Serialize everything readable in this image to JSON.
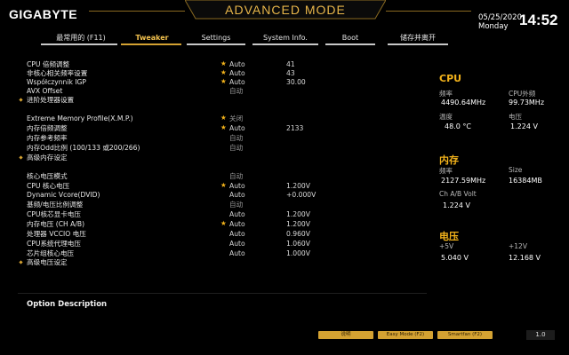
{
  "header": {
    "logo": "GIGABYTE",
    "title": "ADVANCED MODE",
    "date": "05/25/2020",
    "weekday": "Monday",
    "time": "14:52"
  },
  "tabs": [
    {
      "label": "最常用的 (F11)"
    },
    {
      "label": "Tweaker",
      "active": true
    },
    {
      "label": "Settings"
    },
    {
      "label": "System Info."
    },
    {
      "label": "Boot"
    },
    {
      "label": "储存并离开"
    }
  ],
  "rows": [
    {
      "label": "CPU 倍频调整",
      "star": true,
      "v1": "Auto",
      "v2": "41"
    },
    {
      "label": "非核心相关频率设置",
      "star": true,
      "v1": "Auto",
      "v2": "43"
    },
    {
      "label": "Współczynnik IGP",
      "star": true,
      "v1": "Auto",
      "v2": "30.00"
    },
    {
      "label": "AVX Offset",
      "star": false,
      "v1": "自动",
      "v1dim": true,
      "v2": ""
    },
    {
      "label": "进阶处理器设置",
      "bullet": true
    },
    {
      "label": "Extreme Memory Profile(X.M.P.)",
      "star": true,
      "v1": "关闭",
      "v1dim": true,
      "v2": ""
    },
    {
      "label": "内存倍频调整",
      "star": true,
      "v1": "Auto",
      "v2": "2133"
    },
    {
      "label": "内存参考频率",
      "star": false,
      "v1": "自动",
      "v1dim": true,
      "v2": ""
    },
    {
      "label": "内存Odd比例 (100/133 或200/266)",
      "star": false,
      "v1": "自动",
      "v1dim": true,
      "v2": ""
    },
    {
      "label": "高级内存设定",
      "bullet": true
    },
    {
      "label": "核心电压模式",
      "star": false,
      "v1": "自动",
      "v1dim": true,
      "v2": ""
    },
    {
      "label": "CPU 核心电压",
      "star": true,
      "v1": "Auto",
      "v2": "1.200V"
    },
    {
      "label": "Dynamic Vcore(DVID)",
      "star": false,
      "v1": "Auto",
      "v2": "+0.000V"
    },
    {
      "label": "基频/电压比例调整",
      "star": false,
      "v1": "自动",
      "v1dim": true,
      "v2": ""
    },
    {
      "label": "CPU核芯显卡电压",
      "star": false,
      "v1": "Auto",
      "v2": "1.200V"
    },
    {
      "label": "内存电压 (CH A/B)",
      "star": true,
      "v1": "Auto",
      "v2": "1.200V"
    },
    {
      "label": "处理器 VCCIO 电压",
      "star": false,
      "v1": "Auto",
      "v2": "0.960V"
    },
    {
      "label": "CPU系统代理电压",
      "star": false,
      "v1": "Auto",
      "v2": "1.060V"
    },
    {
      "label": "芯片组核心电压",
      "star": false,
      "v1": "Auto",
      "v2": "1.000V"
    },
    {
      "label": "高级电压设定",
      "bullet": true
    }
  ],
  "option_description": "Option Description",
  "side": {
    "cpu": {
      "title": "CPU",
      "freq_label": "频率",
      "freq": "4490.64MHz",
      "ext_label": "CPU外频",
      "ext": "99.73MHz",
      "temp_label": "温度",
      "temp": "48.0 °C",
      "volt_label": "电压",
      "volt": "1.224 V"
    },
    "mem": {
      "title": "内存",
      "freq_label": "频率",
      "freq": "2127.59MHz",
      "size_label": "Size",
      "size": "16384MB",
      "volt_label": "Ch A/B Volt",
      "volt": "1.224 V"
    },
    "power": {
      "title": "电压",
      "p5_label": "+5V",
      "p5": "5.040 V",
      "p12_label": "+12V",
      "p12": "12.168 V"
    }
  },
  "bottom": {
    "help": "说明",
    "easy": "Easy Mode (F2)",
    "smartfan": "Smartfan (F2)",
    "version": "1.0"
  },
  "colors": {
    "accent": "#d4a232",
    "star": "#f2b21b",
    "background": "#000000"
  }
}
